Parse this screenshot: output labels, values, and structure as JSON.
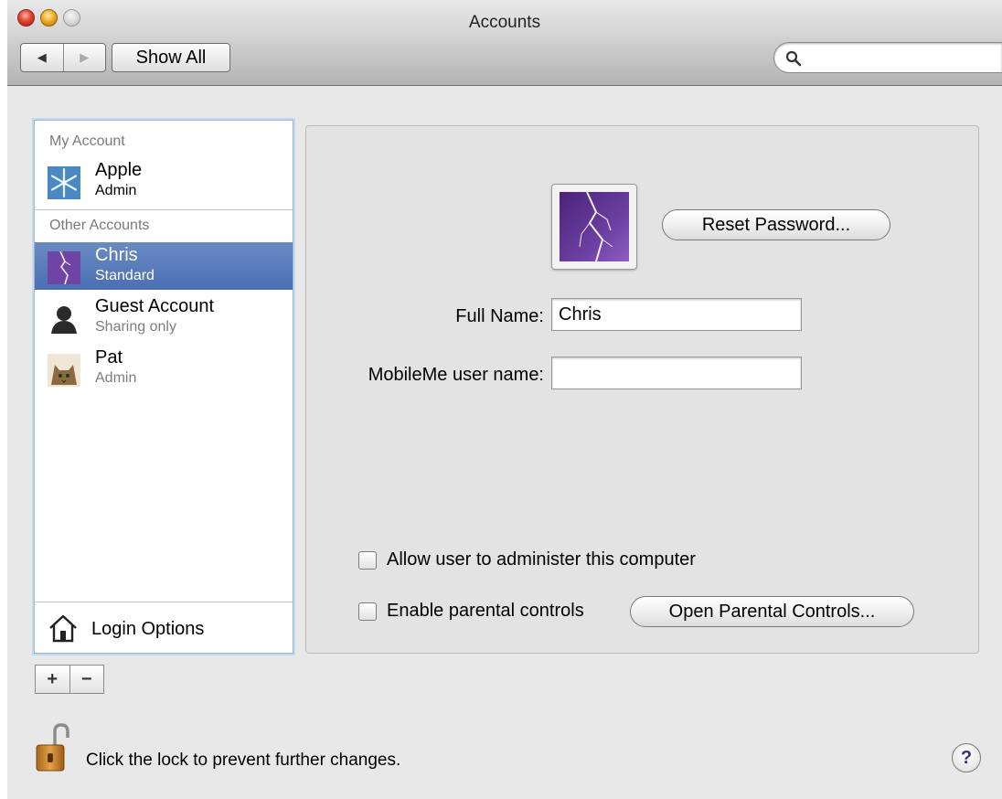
{
  "window": {
    "title": "Accounts"
  },
  "toolbar": {
    "back_glyph": "◀",
    "forward_glyph": "▶",
    "show_all_label": "Show All",
    "search_value": "",
    "search_placeholder": ""
  },
  "sidebar": {
    "my_account_header": "My Account",
    "other_accounts_header": "Other Accounts",
    "accounts": [
      {
        "name": "Apple",
        "role": "Admin",
        "icon": "snowflake-icon"
      },
      {
        "name": "Chris",
        "role": "Standard",
        "icon": "lightning-icon",
        "selected": true
      },
      {
        "name": "Guest Account",
        "role": "Sharing only",
        "icon": "guest-silhouette-icon"
      },
      {
        "name": "Pat",
        "role": "Admin",
        "icon": "cat-icon"
      }
    ],
    "login_options_label": "Login Options",
    "add_glyph": "+",
    "remove_glyph": "−"
  },
  "detail": {
    "reset_password_label": "Reset Password...",
    "full_name_label": "Full Name:",
    "full_name_value": "Chris",
    "mobileme_label": "MobileMe user name:",
    "mobileme_value": "",
    "allow_admin_label": "Allow user to administer this computer",
    "allow_admin_checked": false,
    "parental_controls_label": "Enable parental controls",
    "parental_controls_checked": false,
    "open_parental_label": "Open Parental Controls..."
  },
  "footer": {
    "lock_text": "Click the lock to prevent further changes.",
    "help_glyph": "?"
  },
  "colors": {
    "selection": "#4a6fb3",
    "panel_bg": "#e3e3e3",
    "window_bg": "#e8e8e8",
    "lightning_purple": "#6a3fa0"
  }
}
